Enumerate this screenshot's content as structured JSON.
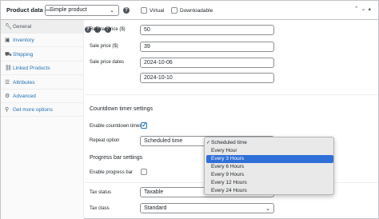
{
  "header": {
    "title": "Product data —",
    "product_type": "Simple product",
    "virtual_label": "Virtual",
    "downloadable_label": "Downloadable",
    "controls": "▲▼▲"
  },
  "sidebar": {
    "items": [
      {
        "label": "General",
        "icon": "wrench-icon"
      },
      {
        "label": "Inventory",
        "icon": "box-icon"
      },
      {
        "label": "Shipping",
        "icon": "truck-icon"
      },
      {
        "label": "Linked Products",
        "icon": "link-icon"
      },
      {
        "label": "Attributes",
        "icon": "list-icon"
      },
      {
        "label": "Advanced",
        "icon": "gear-icon"
      },
      {
        "label": "Get more options",
        "icon": "plugin-icon"
      }
    ]
  },
  "main": {
    "regular_price_label": "Regular price ($)",
    "regular_price_value": "50",
    "sale_price_label": "Sale price ($)",
    "sale_price_value": "39",
    "sale_dates_label": "Sale price dates",
    "sale_date_from": "2024-10-06",
    "sale_date_to": "2024-10-10",
    "countdown_section": "Countdown timer settings",
    "enable_countdown_label": "Enable countdown timer",
    "repeat_option_label": "Repeat option",
    "repeat_option_value": "Scheduled time",
    "progress_section": "Progress bar settings",
    "enable_progress_label": "Enable progress bar",
    "tax_status_label": "Tax status",
    "tax_status_value": "Taxable",
    "tax_class_label": "Tax class",
    "tax_class_value": "Standard"
  },
  "dropdown": {
    "options": [
      "Scheduled time",
      "Every Hour",
      "Every 3 Hours",
      "Every 6 Hours",
      "Every 9 Hours",
      "Every 12 Hours",
      "Every 24 Hours"
    ],
    "selected": "Scheduled time",
    "highlighted": "Every 3 Hours"
  },
  "colors": {
    "accent": "#2271b1",
    "highlight": "#2f6fd8"
  }
}
